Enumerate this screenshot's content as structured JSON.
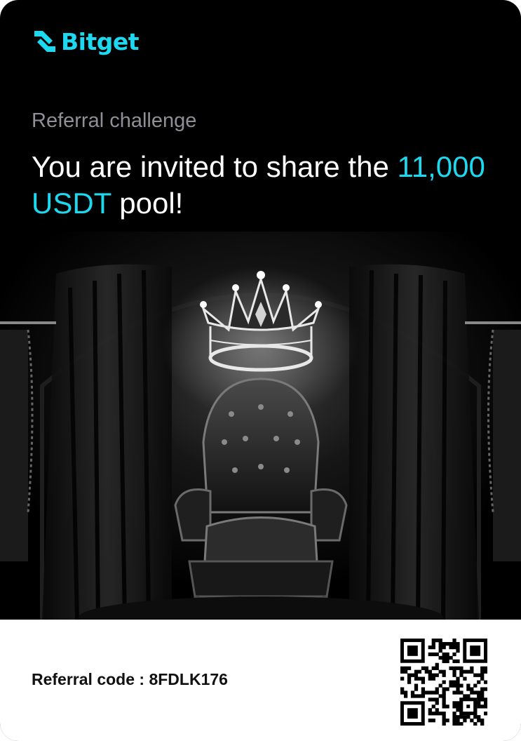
{
  "brand": {
    "name": "Bitget",
    "accent_color": "#1ed8ef",
    "logo_icon": "bitget-logo-icon"
  },
  "promo": {
    "eyebrow": "Referral challenge",
    "headline_prefix": "You are invited to share the ",
    "headline_amount": "11,000 USDT",
    "headline_suffix": " pool!"
  },
  "illustration": {
    "subject": "crown-throne-illustration"
  },
  "footer": {
    "referral_label": "Referral code : ",
    "referral_code": "8FDLK176",
    "qr_icon": "qr-code-icon"
  }
}
